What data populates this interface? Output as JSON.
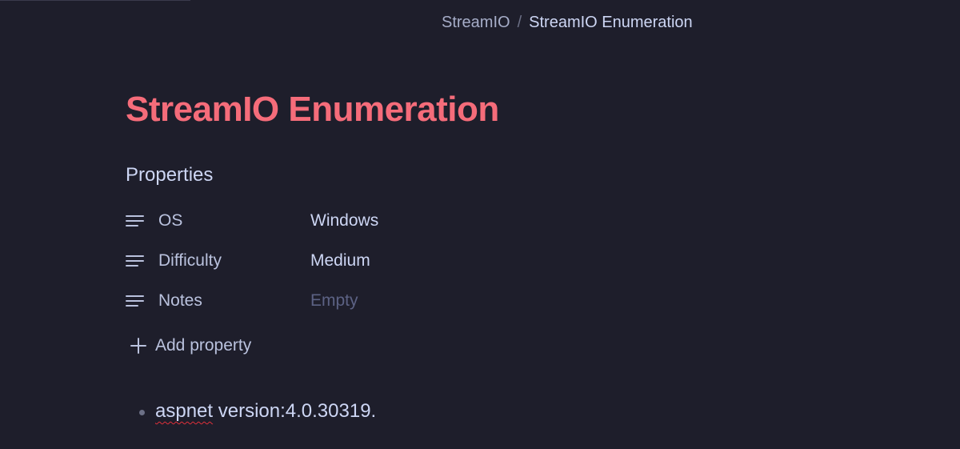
{
  "breadcrumb": {
    "parent": "StreamIO",
    "separator": "/",
    "current": "StreamIO Enumeration"
  },
  "page": {
    "title": "StreamIO Enumeration"
  },
  "properties": {
    "heading": "Properties",
    "items": [
      {
        "icon": "text-lines-icon",
        "key": "OS",
        "value": "Windows",
        "empty": false
      },
      {
        "icon": "text-lines-icon",
        "key": "Difficulty",
        "value": "Medium",
        "empty": false
      },
      {
        "icon": "text-lines-icon",
        "key": "Notes",
        "value": "Empty",
        "empty": true
      }
    ],
    "add_label": "Add property",
    "add_icon": "plus-icon"
  },
  "content": {
    "bullets": [
      {
        "misspelled_word": "aspnet",
        "rest": " version:4.0.30319."
      }
    ]
  },
  "colors": {
    "background": "#1e1e2b",
    "title": "#f56c7a",
    "text": "#cdd6f4",
    "muted": "#5c6284",
    "spellcheck_underline": "#e0303a"
  }
}
